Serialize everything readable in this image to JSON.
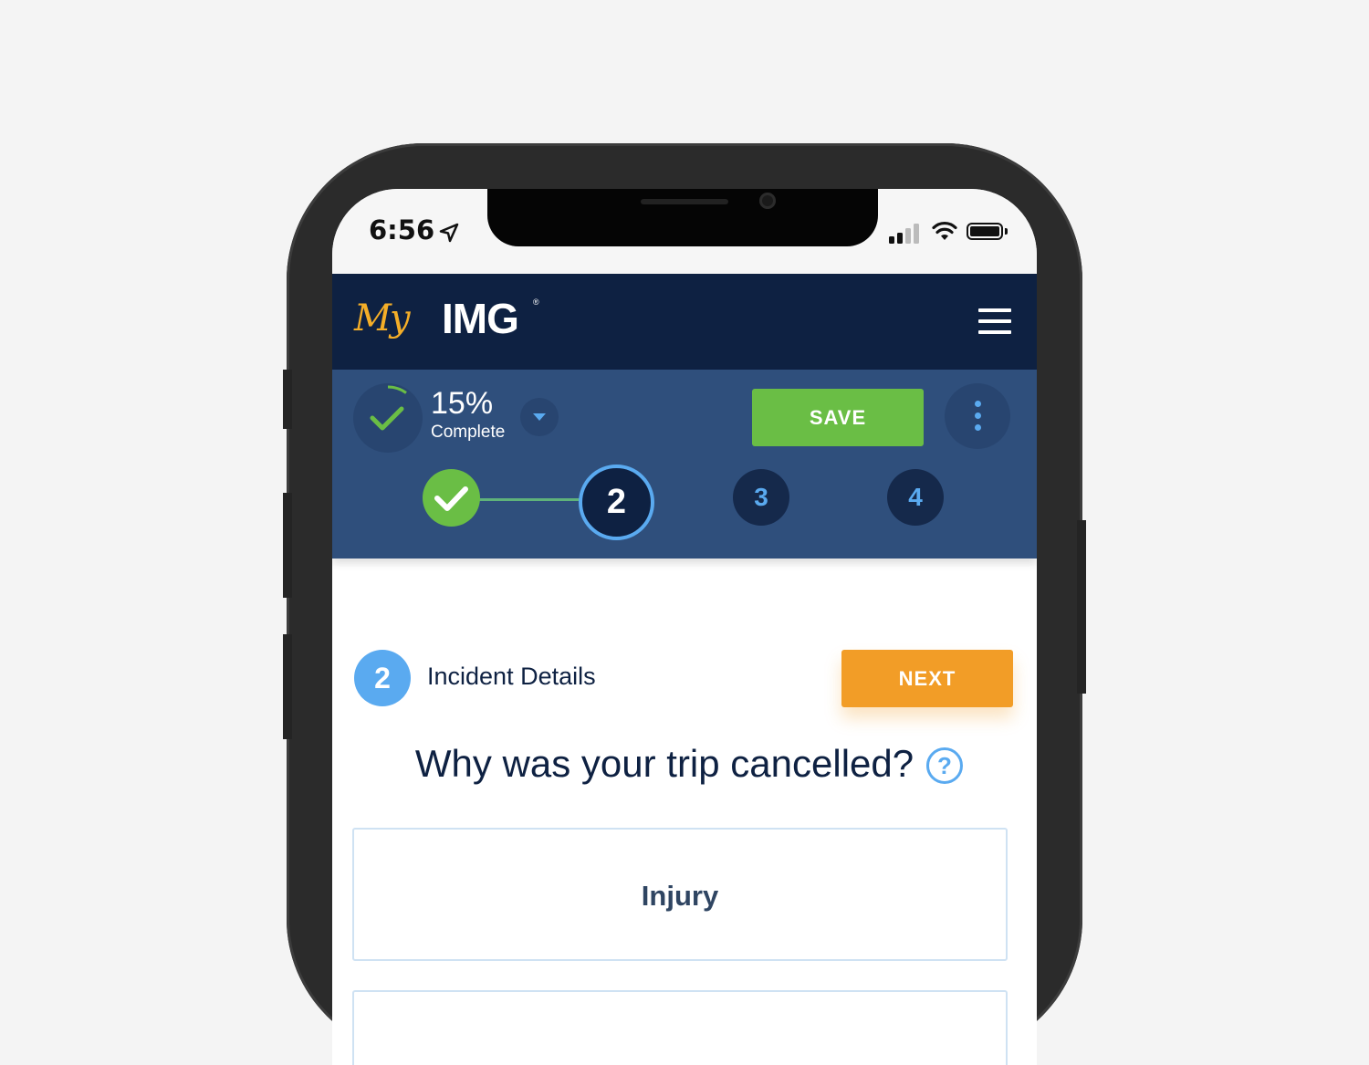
{
  "status_bar": {
    "time": "6:56"
  },
  "header": {
    "logo_script": "My",
    "logo_text": "IMG",
    "logo_registered": "®"
  },
  "progress": {
    "percent": "15%",
    "label": "Complete",
    "save_label": "SAVE"
  },
  "steps": [
    {
      "number": "1",
      "state": "completed"
    },
    {
      "number": "2",
      "state": "current"
    },
    {
      "number": "3",
      "state": "upcoming"
    },
    {
      "number": "4",
      "state": "upcoming"
    }
  ],
  "section": {
    "number": "2",
    "title": "Incident Details",
    "next_label": "NEXT"
  },
  "question": {
    "text": "Why was your trip cancelled?",
    "help_glyph": "?"
  },
  "options": [
    {
      "label": "Injury"
    }
  ],
  "colors": {
    "navy": "#0e2142",
    "panel_blue": "#2f4f7c",
    "accent_blue": "#5aaaf0",
    "save_green": "#6abe45",
    "next_orange": "#f29d27",
    "logo_gold": "#f4ae28"
  }
}
